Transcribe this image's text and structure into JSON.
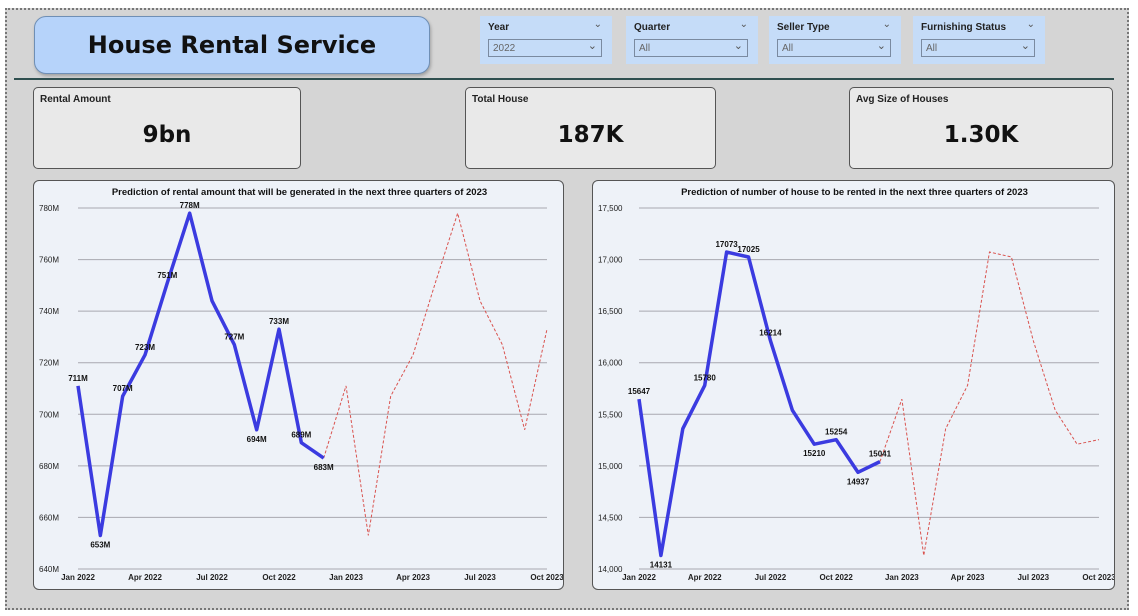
{
  "header": {
    "title": "House Rental Service"
  },
  "slicers": [
    {
      "label": "Year",
      "value": "2022"
    },
    {
      "label": "Quarter",
      "value": "All"
    },
    {
      "label": "Seller Type",
      "value": "All"
    },
    {
      "label": "Furnishing Status",
      "value": "All"
    }
  ],
  "cards": [
    {
      "label": "Rental Amount",
      "value": "9bn"
    },
    {
      "label": "Total House",
      "value": "187K"
    },
    {
      "label": "Avg Size of Houses",
      "value": "1.30K"
    }
  ],
  "colors": {
    "actual": "#3b3be0",
    "forecast": "#d9534f",
    "grid": "#a8a8b0"
  },
  "chart_data": [
    {
      "type": "line",
      "title": "Prediction of rental amount that will be generated in the next three quarters of 2023",
      "x": [
        "2022-01",
        "2022-02",
        "2022-03",
        "2022-04",
        "2022-05",
        "2022-06",
        "2022-07",
        "2022-08",
        "2022-09",
        "2022-10",
        "2022-11",
        "2022-12"
      ],
      "y_ticks": [
        "640M",
        "660M",
        "680M",
        "700M",
        "720M",
        "740M",
        "760M",
        "780M"
      ],
      "ylim": [
        640,
        780
      ],
      "x_ticks": [
        "Jan 2022",
        "Apr 2022",
        "Jul 2022",
        "Oct 2022",
        "Jan 2023",
        "Apr 2023",
        "Jul 2023",
        "Oct 2023"
      ],
      "series": [
        {
          "values": [
            711,
            653,
            707,
            723,
            751,
            778,
            744,
            727,
            694,
            733,
            689,
            683
          ],
          "labels": [
            "711M",
            "653M",
            "707M",
            "723M",
            "751M",
            "778M",
            "",
            "727M",
            "694M",
            "733M",
            "689M",
            "683M"
          ]
        },
        {
          "forecast": true,
          "x": [
            "2022-12",
            "2023-01",
            "2023-02",
            "2023-03",
            "2023-04",
            "2023-05",
            "2023-06",
            "2023-07",
            "2023-08",
            "2023-09",
            "2023-10"
          ],
          "values": [
            683,
            711,
            653,
            707,
            723,
            751,
            778,
            744,
            727,
            694,
            733
          ]
        }
      ]
    },
    {
      "type": "line",
      "title": "Prediction of number of house to be rented in the next three quarters of 2023",
      "x": [
        "2022-01",
        "2022-02",
        "2022-03",
        "2022-04",
        "2022-05",
        "2022-06",
        "2022-07",
        "2022-08",
        "2022-09",
        "2022-10",
        "2022-11",
        "2022-12"
      ],
      "y_ticks": [
        "14,000",
        "14,500",
        "15,000",
        "15,500",
        "16,000",
        "16,500",
        "17,000",
        "17,500"
      ],
      "ylim": [
        14000,
        17500
      ],
      "x_ticks": [
        "Jan 2022",
        "Apr 2022",
        "Jul 2022",
        "Oct 2022",
        "Jan 2023",
        "Apr 2023",
        "Jul 2023",
        "Oct 2023"
      ],
      "series": [
        {
          "values": [
            15647,
            14131,
            15360,
            15780,
            17073,
            17025,
            16214,
            15540,
            15210,
            15254,
            14937,
            15041
          ],
          "labels": [
            "15647",
            "14131",
            "",
            "15780",
            "17073",
            "17025",
            "16214",
            "",
            "15210",
            "15254",
            "14937",
            "15041"
          ]
        },
        {
          "forecast": true,
          "x": [
            "2022-12",
            "2023-01",
            "2023-02",
            "2023-03",
            "2023-04",
            "2023-05",
            "2023-06",
            "2023-07",
            "2023-08",
            "2023-09",
            "2023-10"
          ],
          "values": [
            15041,
            15647,
            14131,
            15360,
            15780,
            17073,
            17025,
            16214,
            15540,
            15210,
            15254
          ]
        }
      ]
    }
  ]
}
